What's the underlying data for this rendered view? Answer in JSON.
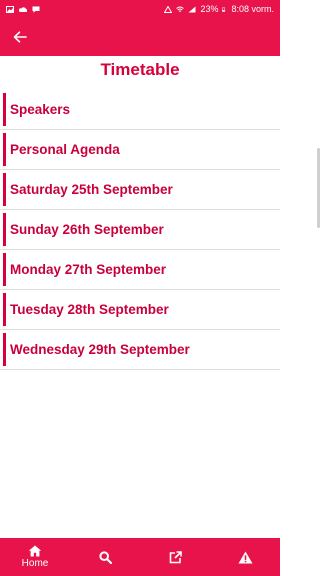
{
  "status_bar": {
    "battery": "23%",
    "time": "8:08 vorm."
  },
  "header": {
    "back_icon": "arrow-left-icon"
  },
  "page": {
    "title": "Timetable"
  },
  "menu_items": [
    {
      "label": "Speakers"
    },
    {
      "label": "Personal Agenda"
    },
    {
      "label": "Saturday 25th September"
    },
    {
      "label": "Sunday 26th September"
    },
    {
      "label": "Monday 27th September"
    },
    {
      "label": "Tuesday 28th September"
    },
    {
      "label": "Wednesday 29th September"
    }
  ],
  "bottom_nav": {
    "home_label": "Home",
    "icons": [
      "home-icon",
      "search-icon",
      "external-link-icon",
      "warning-icon"
    ]
  },
  "colors": {
    "brand": "#e8134a",
    "text_accent": "#c8003b"
  }
}
